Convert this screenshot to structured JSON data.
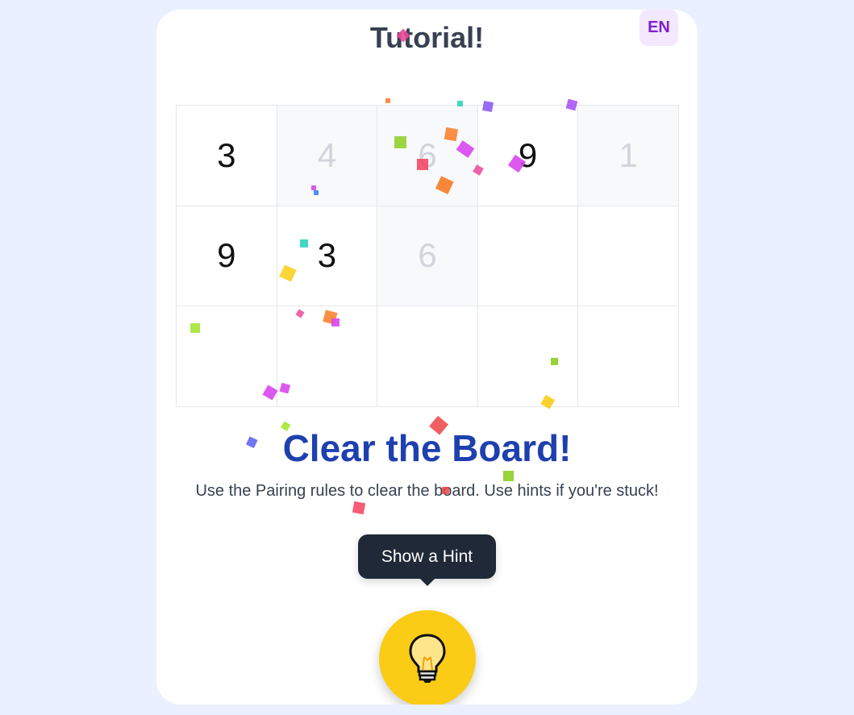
{
  "header": {
    "title": "Tutorial!",
    "language_button": "EN"
  },
  "board": {
    "rows": [
      [
        {
          "value": "3",
          "state": "active"
        },
        {
          "value": "4",
          "state": "used"
        },
        {
          "value": "6",
          "state": "used"
        },
        {
          "value": "9",
          "state": "active"
        },
        {
          "value": "1",
          "state": "used"
        }
      ],
      [
        {
          "value": "9",
          "state": "active"
        },
        {
          "value": "3",
          "state": "active"
        },
        {
          "value": "6",
          "state": "used"
        },
        {
          "value": "",
          "state": "empty"
        },
        {
          "value": "",
          "state": "empty"
        }
      ],
      [
        {
          "value": "",
          "state": "empty"
        },
        {
          "value": "",
          "state": "empty"
        },
        {
          "value": "",
          "state": "empty"
        },
        {
          "value": "",
          "state": "empty"
        },
        {
          "value": "",
          "state": "empty"
        }
      ]
    ]
  },
  "message": {
    "heading": "Clear the Board!",
    "description": "Use the Pairing rules to clear the board. Use hints if you're stuck!"
  },
  "hint": {
    "tooltip": "Show a Hint",
    "icon": "lightbulb-icon"
  },
  "colors": {
    "accent": "#1e40af",
    "hint_button": "#facc15",
    "tooltip_bg": "#1f2937",
    "language_bg": "#f3e8ff",
    "language_text": "#7e22ce"
  }
}
